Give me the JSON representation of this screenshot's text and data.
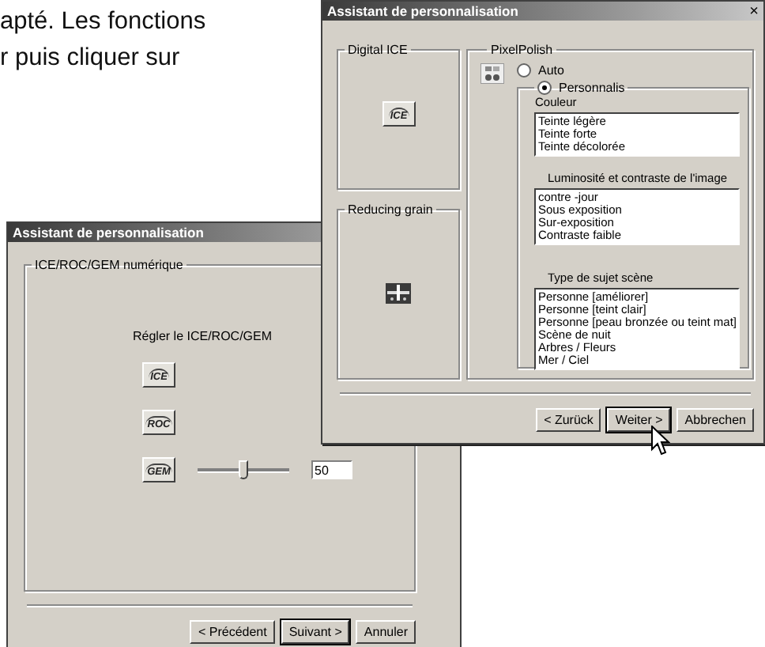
{
  "page_text": [
    "apté. Les fonctions",
    "r puis cliquer sur"
  ],
  "back_dialog": {
    "title": "Assistant de personnalisation",
    "group_title": "ICE/ROC/GEM numérique",
    "instruction": "Régler le ICE/ROC/GEM",
    "filters": [
      {
        "kind": "button",
        "label": "ICE"
      },
      {
        "kind": "button",
        "label": "ROC"
      },
      {
        "kind": "slider",
        "label": "GEM",
        "level": 0.5,
        "value": "50"
      }
    ],
    "buttons": [
      {
        "label": "< Précédent",
        "default": false
      },
      {
        "label": "Suivant >",
        "default": true
      },
      {
        "label": "Annuler",
        "default": false
      }
    ]
  },
  "front_dialog": {
    "title": "Assistant de personnalisation",
    "close": "×",
    "digital_ice": {
      "title": "Digital ICE",
      "button": "ICE"
    },
    "reducing_grain": {
      "title": "Reducing grain"
    },
    "pixel_polish": {
      "title": "PixelPolish",
      "modes": [
        {
          "label": "Auto",
          "selected": false
        },
        {
          "label": "Personnalis",
          "selected": true
        }
      ],
      "lists": [
        {
          "label": "Couleur",
          "items": [
            {
              "text": "Teinte légère",
              "selected": false
            },
            {
              "text": "Teinte forte",
              "selected": false
            },
            {
              "text": "Teinte décolorée",
              "selected": false
            }
          ]
        },
        {
          "label": "Luminosité et contraste de l'image",
          "items": [
            {
              "text": "contre -jour",
              "selected": false
            },
            {
              "text": "Sous exposition",
              "selected": false
            },
            {
              "text": "Sur-exposition",
              "selected": false
            },
            {
              "text": "Contraste faible",
              "selected": false
            }
          ]
        },
        {
          "label": "Type de sujet  scène",
          "items": [
            {
              "text": "Personne [améliorer]",
              "selected": false
            },
            {
              "text": "Personne [teint clair]",
              "selected": false
            },
            {
              "text": "Personne [peau bronzée ou teint mat]",
              "selected": false
            },
            {
              "text": "Scène de nuit",
              "selected": false
            },
            {
              "text": "Arbres / Fleurs",
              "selected": false
            },
            {
              "text": "Mer / Ciel",
              "selected": false
            }
          ]
        }
      ]
    },
    "buttons": [
      {
        "label": "< Zurück",
        "default": false
      },
      {
        "label": "Weiter >",
        "default": true
      },
      {
        "label": "Abbrechen",
        "default": false
      }
    ]
  }
}
